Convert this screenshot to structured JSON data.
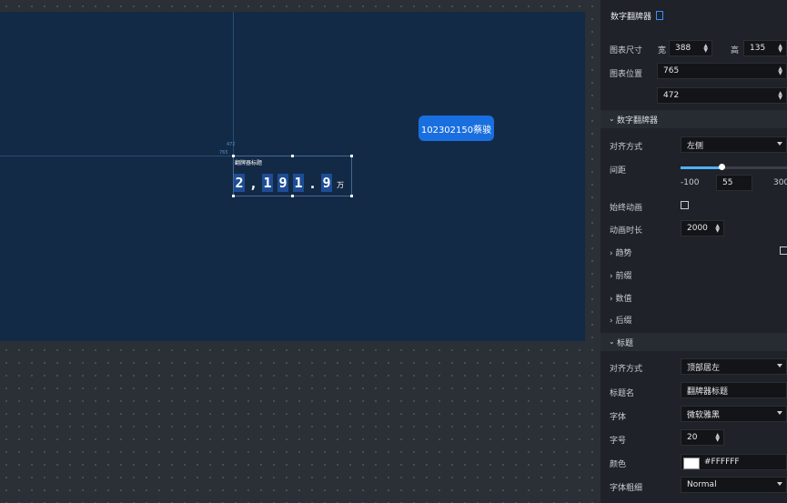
{
  "canvas": {
    "widget_title": "翻牌器标题",
    "digits": [
      "2",
      ",",
      "1",
      "9",
      "1",
      ".",
      "9"
    ],
    "unit": "万",
    "watermark": "102302150蔡骏",
    "guide_tag_top": "472",
    "guide_tag_left": "765"
  },
  "panel": {
    "header": "数字翻牌器",
    "size_label": "图表尺寸",
    "width_label": "宽",
    "width_value": "388",
    "height_label": "高",
    "height_value": "135",
    "position_label": "图表位置",
    "pos_x": "765",
    "pos_y": "472",
    "flipper_section": "数字翻牌器",
    "align_label": "对齐方式",
    "align_value": "左侧",
    "spacing_label": "间距",
    "spacing_min": "-100",
    "spacing_value": "55",
    "spacing_max": "300",
    "spacing_fraction": 0.4,
    "anim_label": "始终动画",
    "duration_label": "动画时长",
    "duration_value": "2000",
    "trend_label": "趋势",
    "prefix_label": "前缀",
    "value_label": "数值",
    "suffix_label": "后缀",
    "title_section": "标题",
    "title_align_label": "对齐方式",
    "title_align_value": "顶部居左",
    "title_name_label": "标题名",
    "title_name_value": "翻牌器标题",
    "font_label": "字体",
    "font_value": "微软雅黑",
    "size_font_label": "字号",
    "size_font_value": "20",
    "color_label": "颜色",
    "color_value": "#FFFFFF",
    "weight_label": "字体粗细",
    "weight_value": "Normal"
  }
}
